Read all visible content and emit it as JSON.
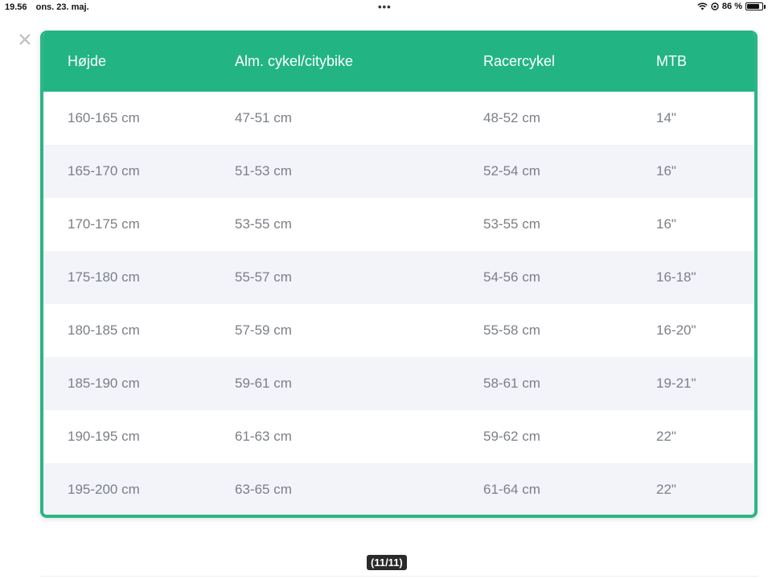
{
  "status_bar": {
    "time": "19.56",
    "date": "ons. 23. maj.",
    "battery": "86 %",
    "battery_level": 0.86
  },
  "table": {
    "columns": [
      "Højde",
      "Alm. cykel/citybike",
      "Racercykel",
      "MTB"
    ],
    "rows": [
      [
        "160-165 cm",
        "47-51 cm",
        "48-52 cm",
        "14\""
      ],
      [
        "165-170 cm",
        "51-53 cm",
        "52-54 cm",
        "16\""
      ],
      [
        "170-175 cm",
        "53-55 cm",
        "53-55 cm",
        "16\""
      ],
      [
        "175-180 cm",
        "55-57 cm",
        "54-56 cm",
        "16-18\""
      ],
      [
        "180-185 cm",
        "57-59 cm",
        "55-58 cm",
        "16-20\""
      ],
      [
        "185-190 cm",
        "59-61 cm",
        "58-61 cm",
        "19-21\""
      ],
      [
        "190-195 cm",
        "61-63 cm",
        "59-62 cm",
        "22\""
      ],
      [
        "195-200 cm",
        "63-65 cm",
        "61-64 cm",
        "22\""
      ]
    ]
  },
  "viewer": {
    "counter": "(11/11)"
  },
  "colors": {
    "header_bg": "#22b583",
    "border": "#2bb685",
    "stripe": "#f3f4f9",
    "cell_text": "#7b7f87"
  }
}
